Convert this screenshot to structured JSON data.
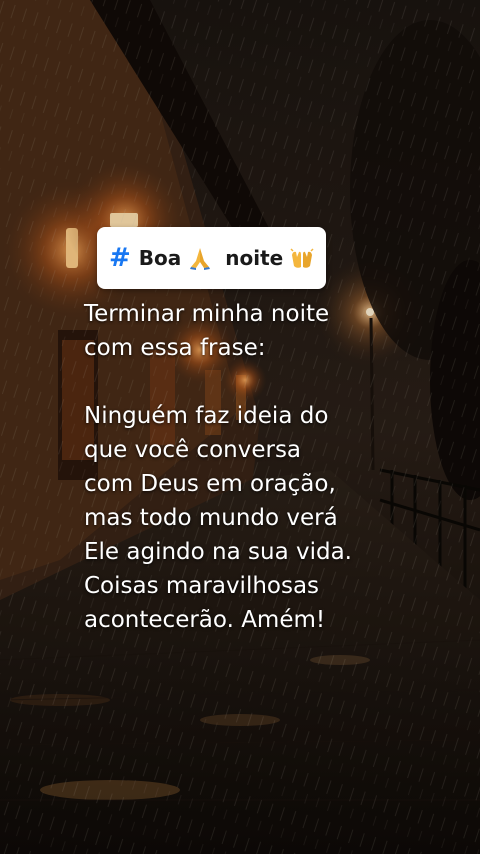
{
  "sticker": {
    "hashtag_symbol": "#",
    "word1": "Boa",
    "emoji1": "praying-hands",
    "word2": "noite",
    "emoji2": "raising-hands"
  },
  "message": {
    "intro": [
      "Terminar minha noite",
      "com essa frase:"
    ],
    "body": [
      "Ninguém faz ideia do",
      "que você conversa",
      "com Deus em oração,",
      "mas todo mundo verá",
      "Ele agindo na sua vida.",
      "Coisas maravilhosas",
      "acontecerão. Amém!"
    ]
  },
  "colors": {
    "hashtag": "#1877f2",
    "sticker_bg": "#ffffff",
    "text": "#ffffff",
    "lamp_glow": "#ff9a3c"
  }
}
